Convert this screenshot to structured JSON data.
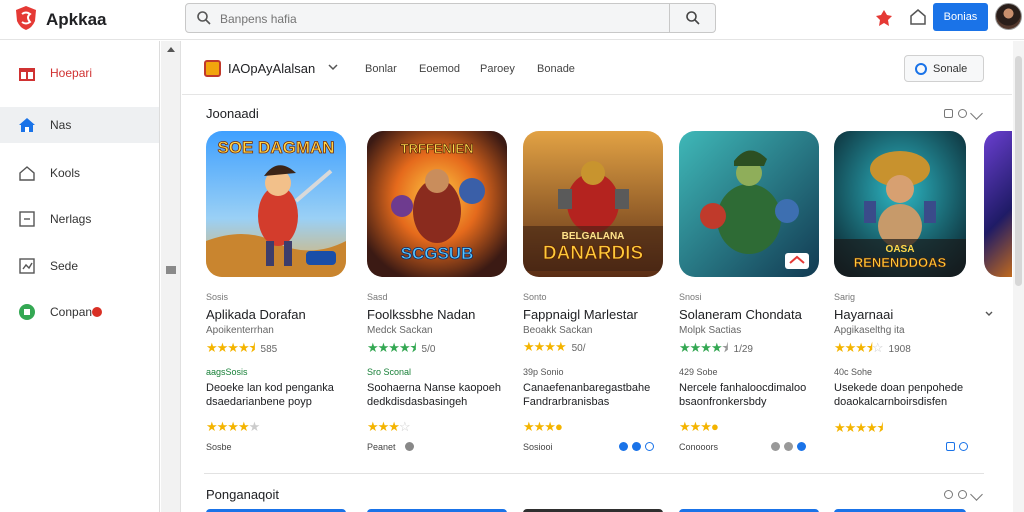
{
  "topbar": {
    "app_name": "Apkkaa",
    "search_placeholder": "Banpens hafia",
    "primary_button": "Bonias"
  },
  "sidebar": {
    "items": [
      {
        "label": "Hoepari",
        "icon": "gift-icon",
        "active": false
      },
      {
        "label": "Nas",
        "icon": "home-icon",
        "active": true
      },
      {
        "label": "Kools",
        "icon": "house-outline-icon",
        "active": false
      },
      {
        "label": "Nerlags",
        "icon": "square-icon",
        "active": false
      },
      {
        "label": "Sede",
        "icon": "chart-icon",
        "active": false
      },
      {
        "label": "Conpan",
        "icon": "green-circle-icon",
        "active": false
      }
    ]
  },
  "filterbar": {
    "category": "IAOpAyAlalsan",
    "filters": [
      "Bonlar",
      "Eoemod",
      "Paroey",
      "Bonade"
    ],
    "sort_label": "Sonale"
  },
  "sections": {
    "first_title": "Joonaadi",
    "second_title": "Ponganaqoit"
  },
  "apps": [
    {
      "title_art": "SOE DAGMAN",
      "category": "Sosis",
      "title": "Aplikada Dorafan",
      "subtitle": "Apoikenterrhan",
      "rating": 4.5,
      "rating_text": "585",
      "tag": "aagsSosis",
      "tag_green": true,
      "desc": "Deoeke lan kod penganka dsaedarianbene poyp",
      "rating2": 4,
      "foot": "Sosbe"
    },
    {
      "title_art": "TRFFENIEN SCGSUB",
      "category": "Sasd",
      "title": "Foolkssbhe Nadan",
      "subtitle": "Medck Sackan",
      "rating": 4.5,
      "rating_text": "5/0",
      "tag": "Sro Sconal",
      "tag_green": true,
      "desc": "Soohaerna Nanse kaopoeh dedkdisdasbasingeh",
      "rating2": 3.5,
      "foot": "Peanet"
    },
    {
      "title_art": "BELGALANA DANARDIS",
      "category": "Sonto",
      "title": "Fappnaigl Marlestar",
      "subtitle": "Beoakk Sackan",
      "rating": 4,
      "rating_text": "50/",
      "tag": "39p Sonio",
      "tag_green": false,
      "desc": "Canaefenanbaregastbahe Fandrarbranisbas",
      "rating2": 3.5,
      "foot": "Sosiooi"
    },
    {
      "title_art": "",
      "category": "Snosi",
      "title": "Solaneram Chondata",
      "subtitle": "Molpk Sactias",
      "rating": 4.5,
      "rating_text": "1/29",
      "tag": "429 Sobe",
      "tag_green": false,
      "desc": "Nercele fanhaloocdimaloo bsaonfronkersbdy",
      "rating2": 3.5,
      "foot": "Conooors"
    },
    {
      "title_art": "OASA RENENDDOAS",
      "category": "Sarig",
      "title": "Hayarnaai",
      "subtitle": "Apgikaselthg ita",
      "rating": 3.5,
      "rating_text": "1908",
      "tag": "40c Sohe",
      "tag_green": false,
      "desc": "Usekede doan penpohede doaokalcarnboirsdisfen",
      "rating2": 4.5,
      "foot": ""
    }
  ]
}
